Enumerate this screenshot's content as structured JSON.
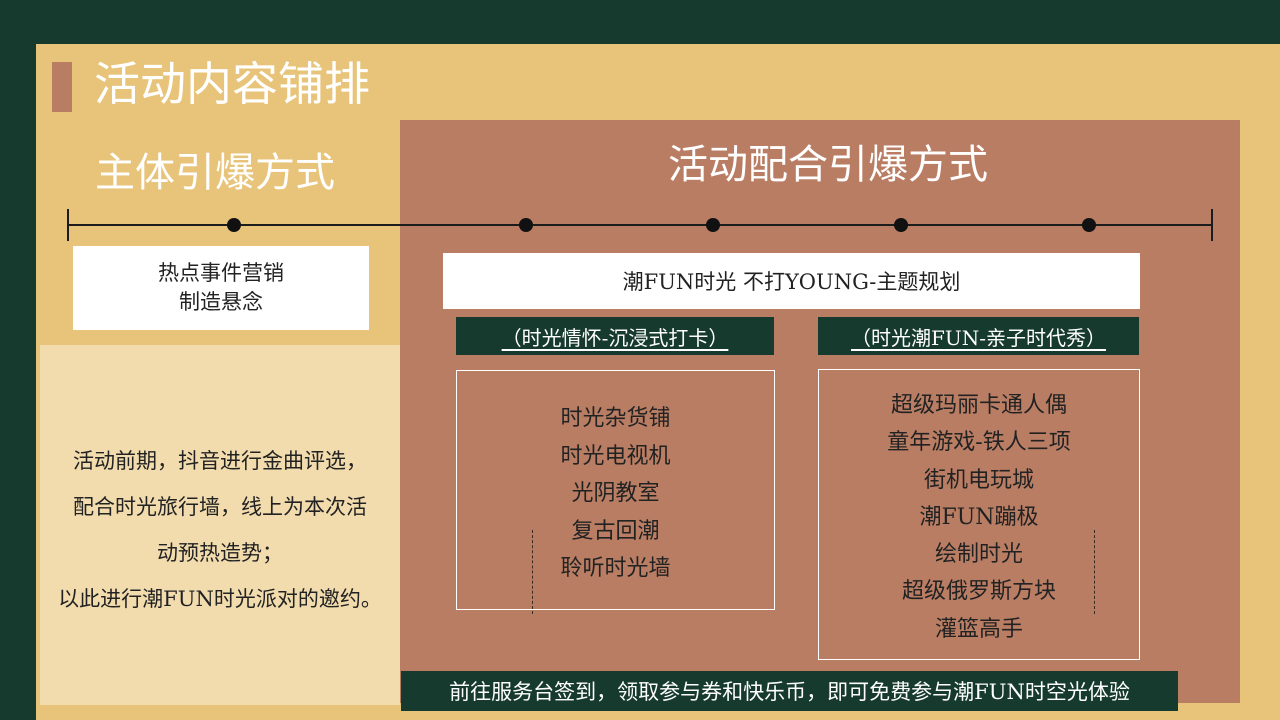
{
  "title": "活动内容铺排",
  "left_heading": "主体引爆方式",
  "right_heading": "活动配合引爆方式",
  "left_box": {
    "line1": "热点事件营销",
    "line2": "制造悬念"
  },
  "left_description": [
    "活动前期，抖音进行金曲评选，",
    "配合时光旅行墙，线上为本次活",
    "动预热造势；",
    "以此进行潮FUN时光派对的邀约。"
  ],
  "theme_bar": "潮FUN时光 不打YOUNG-主题规划",
  "categories": [
    {
      "label": "（时光情怀-沉浸式打卡）",
      "items": [
        "时光杂货铺",
        "时光电视机",
        "光阴教室",
        "复古回潮",
        "聆听时光墙"
      ]
    },
    {
      "label": "（时光潮FUN-亲子时代秀）",
      "items": [
        "超级玛丽卡通人偶",
        "童年游戏-铁人三项",
        "街机电玩城",
        "潮FUN蹦极",
        "绘制时光",
        "超级俄罗斯方块",
        "灌篮高手"
      ]
    }
  ],
  "footer": "前往服务台签到，领取参与券和快乐币，即可免费参与潮FUN时空光体验",
  "colors": {
    "background": "#173a2f",
    "slide": "#e8c47b",
    "panel_brown": "#b97d64",
    "panel_light": "#f2dcae",
    "dark_green": "#173a2f"
  }
}
